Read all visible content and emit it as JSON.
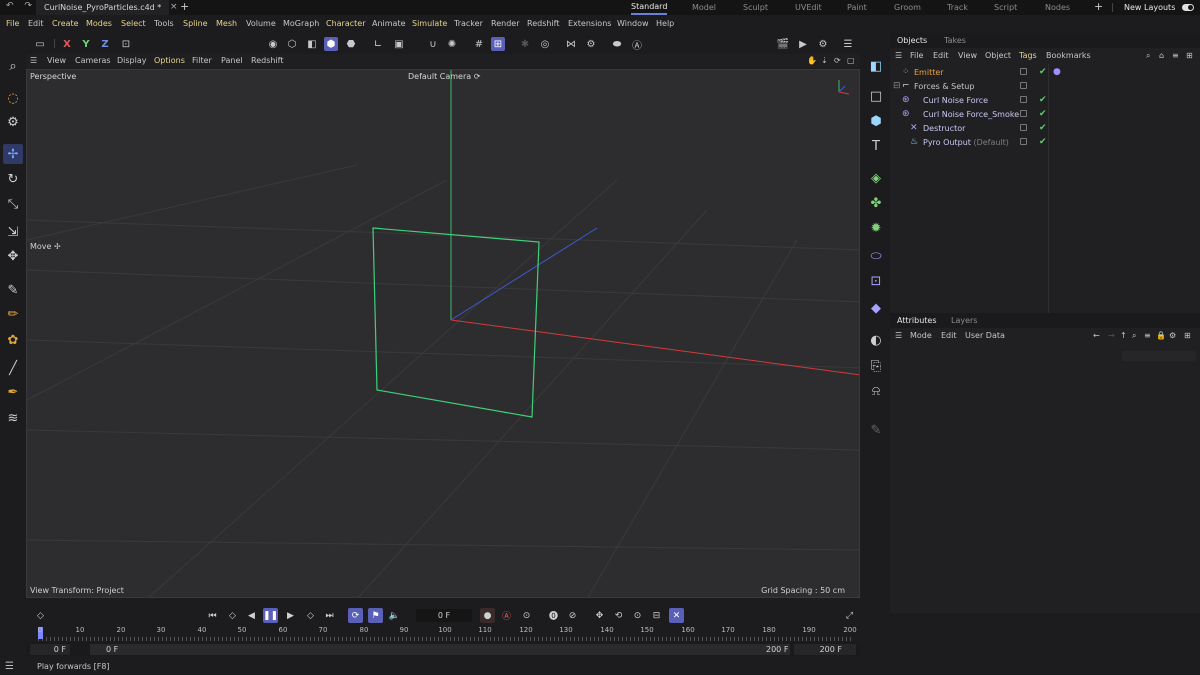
{
  "titlebar": {
    "history_icons": "↶ ↷",
    "tab_title": "CurlNoise_PyroParticles.c4d *",
    "tab_close": "×",
    "new_tab": "+",
    "layouts": [
      "Standard",
      "Model",
      "Sculpt",
      "UVEdit",
      "Paint",
      "Groom",
      "Track",
      "Script",
      "Nodes"
    ],
    "active_layout": "Standard",
    "add_layout": "+",
    "new_layouts_label": "New Layouts"
  },
  "menubar": {
    "items": [
      "File",
      "Edit",
      "Create",
      "Modes",
      "Select",
      "Tools",
      "Spline",
      "Mesh",
      "Volume",
      "MoGraph",
      "Character",
      "Animate",
      "Simulate",
      "Tracker",
      "Render",
      "Redshift",
      "Extensions",
      "Window",
      "Help"
    ]
  },
  "toolbar": {
    "axis_x": "X",
    "axis_y": "Y",
    "axis_z": "Z"
  },
  "viewport": {
    "menu": [
      "View",
      "Cameras",
      "Display",
      "Options",
      "Filter",
      "Panel",
      "Redshift"
    ],
    "active_menu": "Options",
    "label": "Perspective",
    "camera": "Default Camera ⟳",
    "tool": "Move ✢",
    "view_transform": "View Transform: Project",
    "grid_spacing": "Grid Spacing : 50 cm",
    "axis_colors": {
      "x": "#d23b3b",
      "y": "#3fb86a",
      "z": "#3b5bd2",
      "selection": "#3fd17a"
    }
  },
  "objects_panel": {
    "tabs": [
      "Objects",
      "Takes"
    ],
    "menu": [
      "File",
      "Edit",
      "View",
      "Object",
      "Tags",
      "Bookmarks"
    ],
    "items": [
      {
        "name": "Emitter",
        "icon": "emitter-icon"
      },
      {
        "name": "Forces & Setup",
        "icon": "null-icon"
      },
      {
        "name": "Curl Noise Force",
        "icon": "force-icon"
      },
      {
        "name": "Curl Noise Force_Smoke",
        "icon": "force-icon"
      },
      {
        "name": "Destructor",
        "icon": "destructor-icon"
      },
      {
        "name": "Pyro Output",
        "suffix": "(Default)",
        "icon": "pyro-icon"
      }
    ]
  },
  "attributes_panel": {
    "tabs": [
      "Attributes",
      "Layers"
    ],
    "menu": [
      "Mode",
      "Edit",
      "User Data"
    ]
  },
  "timeline": {
    "current_frame": "0 F",
    "ticks": [
      "0",
      "10",
      "20",
      "30",
      "40",
      "50",
      "60",
      "70",
      "80",
      "90",
      "100",
      "110",
      "120",
      "130",
      "140",
      "150",
      "160",
      "170",
      "180",
      "190",
      "200"
    ],
    "range_start": "0 F",
    "range_start_inner": "0 F",
    "range_end_inner": "200 F",
    "range_end": "200 F"
  },
  "status": {
    "text": "Play forwards [F8]"
  }
}
